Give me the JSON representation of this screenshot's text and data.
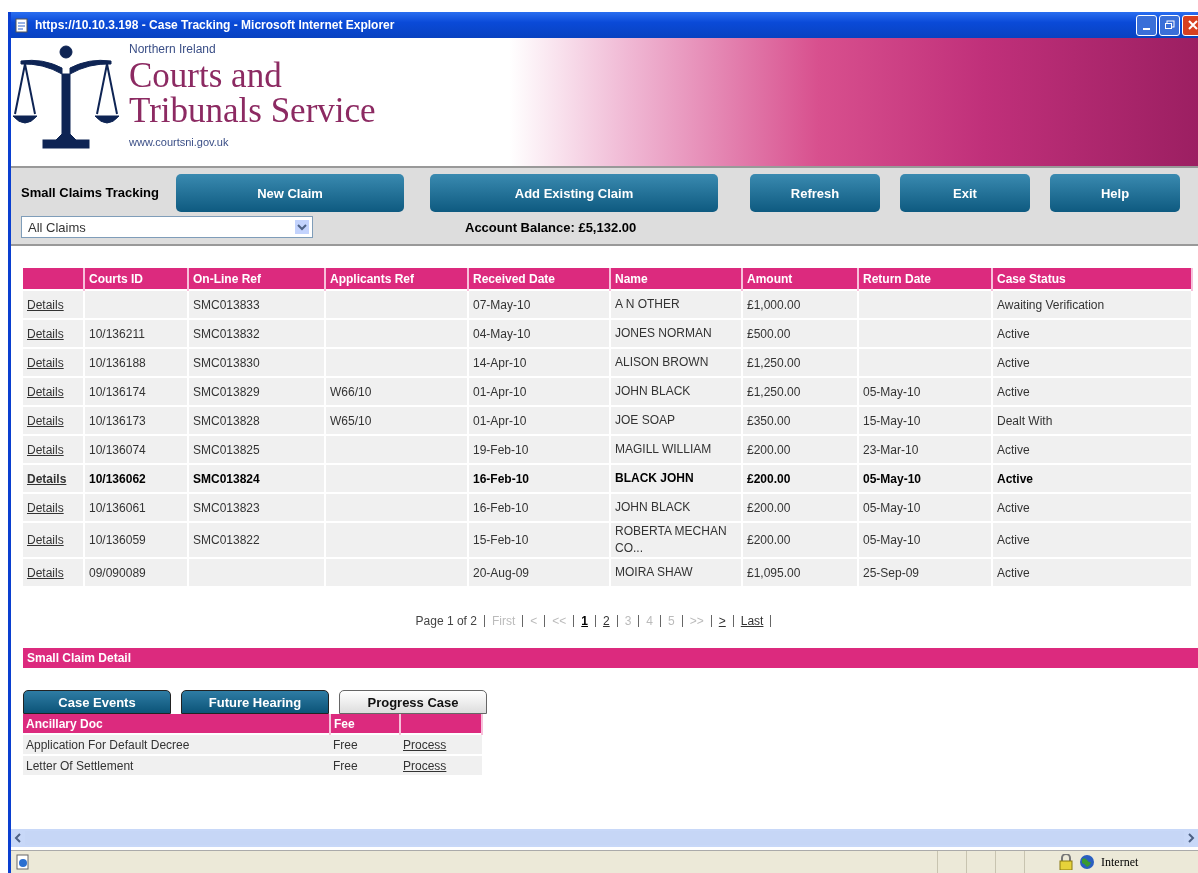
{
  "window": {
    "title": "https://10.10.3.198 - Case Tracking - Microsoft Internet Explorer"
  },
  "header": {
    "region": "Northern Ireland",
    "org_line_1": "Courts and",
    "org_line_2": "Tribunals Service",
    "url": "www.courtsni.gov.uk"
  },
  "toolbar": {
    "title": "Small Claims Tracking",
    "buttons": [
      "New Claim",
      "Add Existing Claim",
      "Refresh",
      "Exit",
      "Help"
    ],
    "filter": {
      "value": "All Claims"
    },
    "balance": "Account Balance: £5,132.00"
  },
  "table": {
    "columns": [
      "",
      "Courts ID",
      "On-Line Ref",
      "Applicants Ref",
      "Received Date",
      "Name",
      "Amount",
      "Return Date",
      "Case Status"
    ],
    "rows": [
      {
        "selected": false,
        "cells": [
          "Details",
          "",
          "SMC013833",
          "",
          "07-May-10",
          "A N OTHER",
          "£1,000.00",
          "",
          "Awaiting Verification"
        ]
      },
      {
        "selected": false,
        "cells": [
          "Details",
          "10/136211",
          "SMC013832",
          "",
          "04-May-10",
          "JONES NORMAN",
          "£500.00",
          "",
          "Active"
        ]
      },
      {
        "selected": false,
        "cells": [
          "Details",
          "10/136188",
          "SMC013830",
          "",
          "14-Apr-10",
          "ALISON BROWN",
          "£1,250.00",
          "",
          "Active"
        ]
      },
      {
        "selected": false,
        "cells": [
          "Details",
          "10/136174",
          "SMC013829",
          "W66/10",
          "01-Apr-10",
          "JOHN BLACK",
          "£1,250.00",
          "05-May-10",
          "Active"
        ]
      },
      {
        "selected": false,
        "cells": [
          "Details",
          "10/136173",
          "SMC013828",
          "W65/10",
          "01-Apr-10",
          "JOE SOAP",
          "£350.00",
          "15-May-10",
          "Dealt With"
        ]
      },
      {
        "selected": false,
        "cells": [
          "Details",
          "10/136074",
          "SMC013825",
          "",
          "19-Feb-10",
          "MAGILL WILLIAM",
          "£200.00",
          "23-Mar-10",
          "Active"
        ]
      },
      {
        "selected": true,
        "cells": [
          "Details",
          "10/136062",
          "SMC013824",
          "",
          "16-Feb-10",
          "BLACK JOHN",
          "£200.00",
          "05-May-10",
          "Active"
        ]
      },
      {
        "selected": false,
        "cells": [
          "Details",
          "10/136061",
          "SMC013823",
          "",
          "16-Feb-10",
          "JOHN BLACK",
          "£200.00",
          "05-May-10",
          "Active"
        ]
      },
      {
        "selected": false,
        "cells": [
          "Details",
          "10/136059",
          "SMC013822",
          "",
          "15-Feb-10",
          "ROBERTA MECHAN CO...",
          "£200.00",
          "05-May-10",
          "Active"
        ]
      },
      {
        "selected": false,
        "cells": [
          "Details",
          "09/090089",
          "",
          "",
          "20-Aug-09",
          "MOIRA SHAW",
          "£1,095.00",
          "25-Sep-09",
          "Active"
        ]
      }
    ]
  },
  "pager": [
    {
      "kind": "label",
      "text": "Page 1 of 2"
    },
    {
      "kind": "disabled",
      "text": "First"
    },
    {
      "kind": "disabled",
      "text": "<"
    },
    {
      "kind": "disabled",
      "text": "<<"
    },
    {
      "kind": "current",
      "text": "1"
    },
    {
      "kind": "link",
      "text": "2"
    },
    {
      "kind": "disabled",
      "text": "3"
    },
    {
      "kind": "disabled",
      "text": "4"
    },
    {
      "kind": "disabled",
      "text": "5"
    },
    {
      "kind": "disabled",
      "text": ">>"
    },
    {
      "kind": "link",
      "text": ">"
    },
    {
      "kind": "link",
      "text": "Last"
    }
  ],
  "detail": {
    "title": "Small Claim Detail",
    "tabs": [
      {
        "label": "Case Events",
        "selected": false
      },
      {
        "label": "Future Hearing",
        "selected": false
      },
      {
        "label": "Progress Case",
        "selected": true
      }
    ],
    "columns": [
      "Ancillary Doc",
      "Fee",
      ""
    ],
    "rows": [
      {
        "doc": "Application For Default Decree",
        "fee": "Free",
        "action": "Process"
      },
      {
        "doc": "Letter Of Settlement",
        "fee": "Free",
        "action": "Process"
      }
    ]
  },
  "status_bar": {
    "zone": "Internet"
  }
}
